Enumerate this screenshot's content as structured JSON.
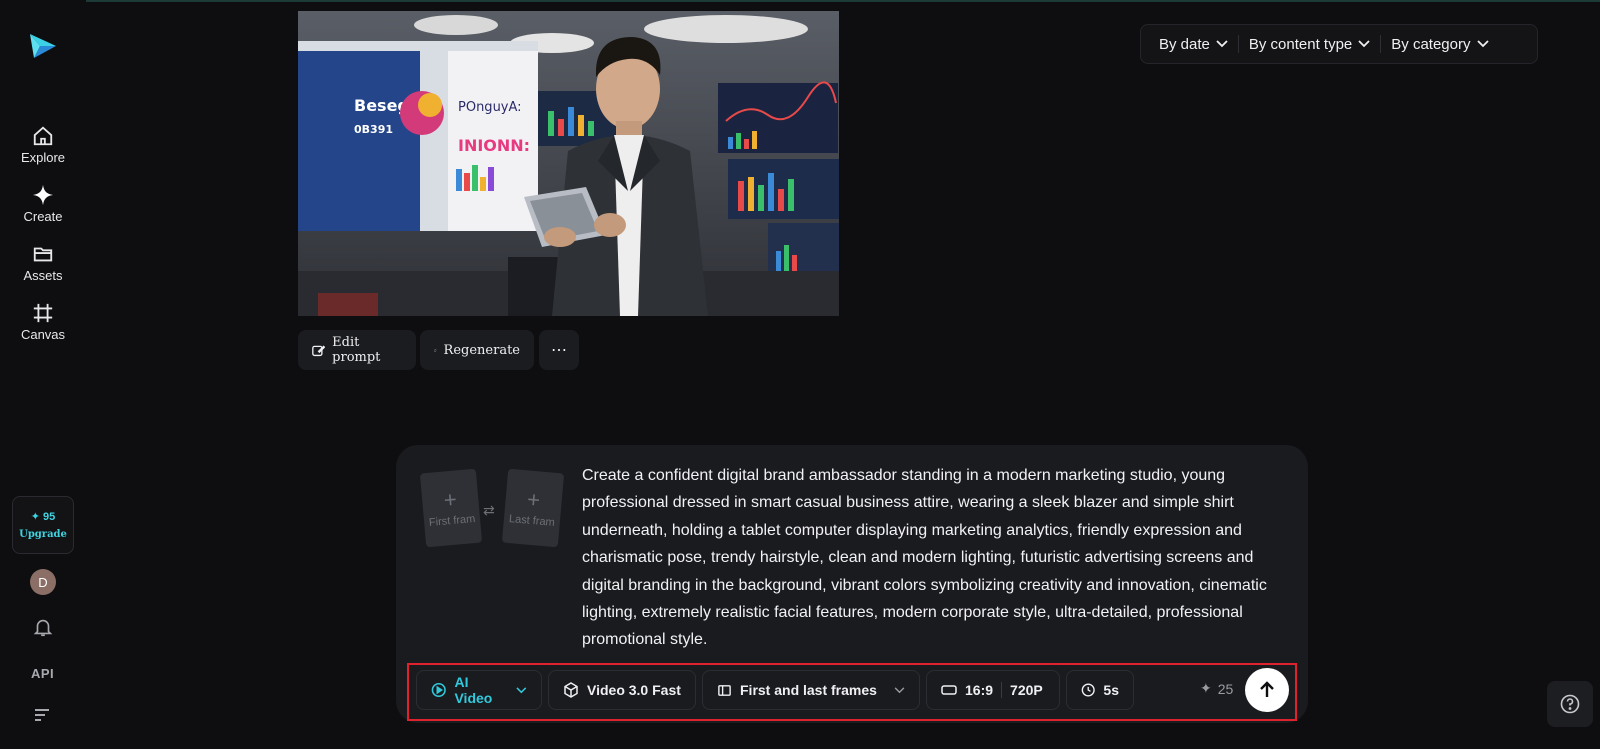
{
  "sidebar": {
    "items": [
      {
        "label": "Explore",
        "icon": "home-icon"
      },
      {
        "label": "Create",
        "icon": "sparkle-icon"
      },
      {
        "label": "Assets",
        "icon": "folder-icon"
      },
      {
        "label": "Canvas",
        "icon": "frame-icon"
      }
    ],
    "credits": "✦ 95",
    "upgrade_label": "Upgrade",
    "avatar_initial": "D",
    "api_label": "API"
  },
  "filters": [
    {
      "label": "By date"
    },
    {
      "label": "By content type"
    },
    {
      "label": "By category"
    }
  ],
  "preview": {
    "poster_text_1": "Besega",
    "poster_text_2": "0B391",
    "poster_text_3": "POnguyA:",
    "poster_text_4": "INIONN:"
  },
  "actions": {
    "edit_prompt": "Edit prompt",
    "regenerate": "Regenerate",
    "more": "⋯"
  },
  "prompt": {
    "first_frame": "First fram",
    "last_frame": "Last fram",
    "text": "Create a confident digital brand ambassador standing in a modern marketing studio, young professional dressed in smart casual business attire, wearing a sleek blazer and simple shirt underneath, holding a tablet computer displaying marketing analytics, friendly expression and charismatic pose, trendy hairstyle, clean and modern lighting, futuristic advertising screens and digital branding in the background, vibrant colors symbolizing creativity and innovation, cinematic lighting, extremely realistic facial features, modern corporate style, ultra-detailed, professional promotional style."
  },
  "toolbar": {
    "mode": "AI Video",
    "model": "Video 3.0 Fast",
    "frames": "First and last frames",
    "ratio": "16:9",
    "resolution": "720P",
    "duration": "5s",
    "cost": "25"
  },
  "colors": {
    "accent": "#33c9dc",
    "highlight_outline": "#e0222e",
    "background": "#0e0e10",
    "card": "#1a1b1f"
  }
}
